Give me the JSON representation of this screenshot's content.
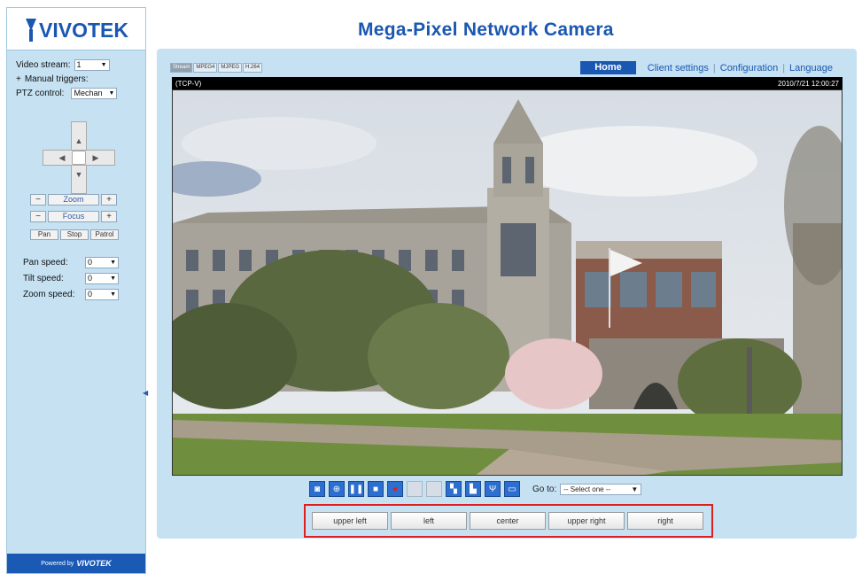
{
  "header": {
    "title": "Mega-Pixel Network Camera"
  },
  "logo": {
    "text": "VIVOTEK"
  },
  "sidebar": {
    "video_stream_label": "Video stream:",
    "video_stream_value": "1",
    "manual_triggers_label": "Manual triggers:",
    "ptz_control_label": "PTZ control:",
    "ptz_control_value": "Mechan",
    "zoom_label": "Zoom",
    "focus_label": "Focus",
    "small_buttons": [
      "Pan",
      "Stop",
      "Patrol"
    ],
    "pan_speed_label": "Pan speed:",
    "pan_speed_value": "0",
    "tilt_speed_label": "Tilt speed:",
    "tilt_speed_value": "0",
    "zoom_speed_label": "Zoom speed:",
    "zoom_speed_value": "0",
    "powered_by": "Powered by",
    "powered_brand": "VIVOTEK"
  },
  "stream_tabs": [
    "Stream",
    "MPEG4",
    "MJPEG",
    "H.264"
  ],
  "nav": {
    "home": "Home",
    "client_settings": "Client settings",
    "configuration": "Configuration",
    "language": "Language"
  },
  "video": {
    "left_caption": "(TCP-V)",
    "timestamp": "2010/7/21 12:00:27"
  },
  "toolbar": {
    "icons": [
      "snapshot-icon",
      "zoom-icon",
      "pause-icon",
      "stop-icon",
      "record-icon",
      "volume-icon",
      "mute-icon",
      "panorama-icon",
      "image-icon",
      "usb-icon",
      "fullscreen-icon"
    ],
    "goto_label": "Go to:",
    "goto_value": "-- Select one --"
  },
  "presets": [
    "upper left",
    "left",
    "center",
    "upper right",
    "right"
  ]
}
